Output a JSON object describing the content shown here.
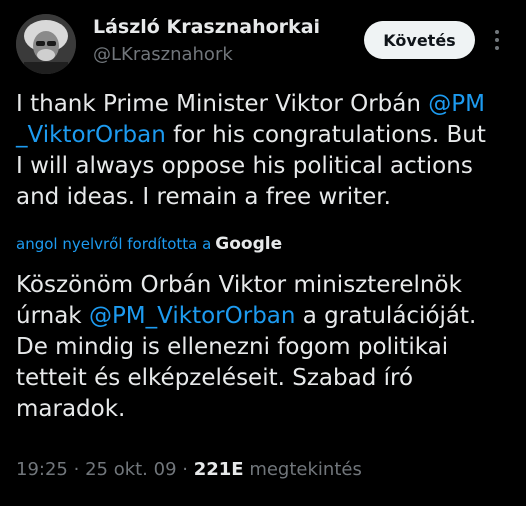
{
  "author": {
    "display_name": "László Krasznahorkai",
    "handle": "@LKrasznahork"
  },
  "follow_button_label": "Követés",
  "more_icon": "more-vertical-icon",
  "original_text": {
    "l1_a": "I thank Prime Minister Viktor Orbán ",
    "l1_mention": "@PM",
    "l2_mention": "_ViktorOrban",
    "l2_b": "  for his congratulations. But",
    "l3": "I will always oppose his political actions",
    "l4": "and ideas. I remain a free writer."
  },
  "translation": {
    "label": "angol nyelvről fordította a",
    "provider": "Google"
  },
  "translated_text": {
    "l1": "Köszönöm Orbán Viktor miniszterelnök",
    "l2_a": "úrnak ",
    "l2_mention": "@PM_ViktorOrban",
    "l2_b": " a gratulációját.",
    "l3": "De mindig is ellenezni fogom politikai",
    "l4": "tetteit és elképzeléseit. Szabad író",
    "l5": "maradok."
  },
  "meta": {
    "time": "19:25",
    "date": "25 okt. 09",
    "views_count": "221E",
    "views_label": "megtekintés"
  },
  "colors": {
    "background": "#000000",
    "text": "#e7e9ea",
    "secondary": "#71767b",
    "link": "#1d9bf0",
    "button_bg": "#eff3f4"
  }
}
